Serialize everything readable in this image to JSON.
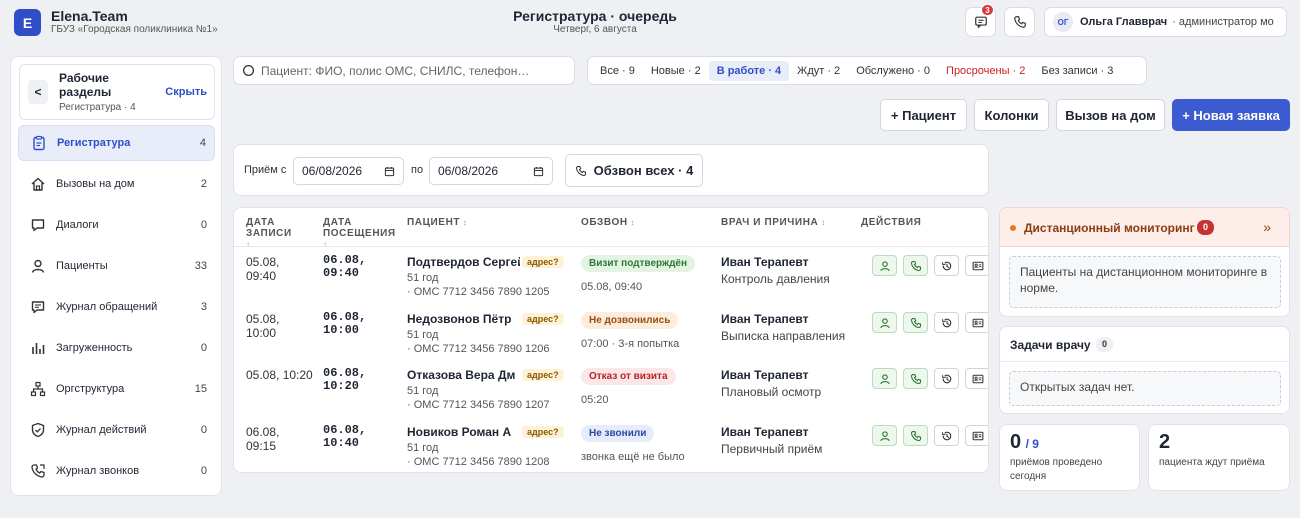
{
  "header": {
    "logo_letter": "E",
    "brand": "Elena.Team",
    "org": "ГБУЗ «Городская поликлиника №1»",
    "title": "Регистратура · очередь",
    "subtitle": "Четверг, 6 августа",
    "messages_badge": "3",
    "user_initials": "ОГ",
    "user_name": "Ольга Главврач",
    "user_role": "· администратор мо"
  },
  "sidebar": {
    "back_label": "<",
    "title": "Рабочие разделы",
    "subtitle": "Регистратура · 4",
    "hide_label": "Скрыть",
    "items": [
      {
        "label": "Регистратура",
        "count": "4",
        "icon": "clipboard-icon"
      },
      {
        "label": "Вызовы на дом",
        "count": "2",
        "icon": "home-icon"
      },
      {
        "label": "Диалоги",
        "count": "0",
        "icon": "chat-icon"
      },
      {
        "label": "Пациенты",
        "count": "33",
        "icon": "user-icon"
      },
      {
        "label": "Журнал обращений",
        "count": "3",
        "icon": "message-icon"
      },
      {
        "label": "Загруженность",
        "count": "0",
        "icon": "bar-chart-icon"
      },
      {
        "label": "Оргструктура",
        "count": "15",
        "icon": "org-tree-icon"
      },
      {
        "label": "Журнал действий",
        "count": "0",
        "icon": "shield-icon"
      },
      {
        "label": "Журнал звонков",
        "count": "0",
        "icon": "phone-icon"
      }
    ]
  },
  "search": {
    "placeholder": "Пациент: ФИО, полис ОМС, СНИЛС, телефон…"
  },
  "filters": [
    {
      "label": "Все · 9",
      "state": "normal"
    },
    {
      "label": "Новые · 2",
      "state": "normal"
    },
    {
      "label": "В работе · 4",
      "state": "active"
    },
    {
      "label": "Ждут · 2",
      "state": "normal"
    },
    {
      "label": "Обслужено · 0",
      "state": "normal"
    },
    {
      "label": "Просрочены · 2",
      "state": "red"
    },
    {
      "label": "Без записи · 3",
      "state": "normal"
    }
  ],
  "actions": {
    "patient": "+ Пациент",
    "columns": "Колонки",
    "home_call": "Вызов на дом",
    "new_request": "+ Новая заявка"
  },
  "date_filter": {
    "from_label": "Приём с",
    "from_value": "06/08/2026",
    "to_label": "по",
    "to_value": "06/08/2026",
    "call_all": "Обзвон всех · 4"
  },
  "table": {
    "columns": [
      "ДАТА ЗАПИСИ",
      "ДАТА ПОСЕЩЕНИЯ",
      "ПАЦИЕНТ",
      "ОБЗВОН",
      "ВРАЧ И ПРИЧИНА",
      "ДЕЙСТВИЯ"
    ],
    "rows": [
      {
        "rec_date": "05.08,",
        "rec_time": "09:40",
        "visit_date": "06.08,",
        "visit_time": "09:40",
        "patient": "Подтвердов Сергей",
        "addr": "адрес?",
        "age": "51 год",
        "oms": "· ОМС 7712 3456 7890 1205",
        "status": "Визит подтверждён",
        "status_kind": "green",
        "status_note": "05.08, 09:40",
        "doctor": "Иван Терапевт",
        "reason": "Контроль давления"
      },
      {
        "rec_date": "05.08,",
        "rec_time": "10:00",
        "visit_date": "06.08,",
        "visit_time": "10:00",
        "patient": "Недозвонов Пётр",
        "addr": "адрес?",
        "age": "51 год",
        "oms": "· ОМС 7712 3456 7890 1206",
        "status": "Не дозвонились",
        "status_kind": "orange",
        "status_note": "07:00 · 3-я попытка",
        "doctor": "Иван Терапевт",
        "reason": "Выписка направления"
      },
      {
        "rec_date": "05.08, 10:20",
        "rec_time": "",
        "visit_date": "06.08,",
        "visit_time": "10:20",
        "patient": "Отказова Вера Дм",
        "addr": "адрес?",
        "age": "51 год",
        "oms": "· ОМС 7712 3456 7890 1207",
        "status": "Отказ от визита",
        "status_kind": "red",
        "status_note": "05:20",
        "doctor": "Иван Терапевт",
        "reason": "Плановый осмотр"
      },
      {
        "rec_date": "06.08,",
        "rec_time": "09:15",
        "visit_date": "06.08,",
        "visit_time": "10:40",
        "patient": "Новиков Роман А",
        "addr": "адрес?",
        "age": "51 год",
        "oms": "· ОМС 7712 3456 7890 1208",
        "status": "Не звонили",
        "status_kind": "blue",
        "status_note": "звонка ещё не было",
        "doctor": "Иван Терапевт",
        "reason": "Первичный приём"
      }
    ]
  },
  "monitoring": {
    "title": "Дистанционный мониторинг",
    "count": "0",
    "expand": "»",
    "message": "Пациенты на дистанционном мониторинге в норме."
  },
  "tasks": {
    "title": "Задачи врачу",
    "count": "0",
    "message": "Открытых задач нет."
  },
  "stats": {
    "done_value": "0",
    "done_total": "/ 9",
    "done_label": "приёмов проведено сегодня",
    "waiting_value": "2",
    "waiting_label": "пациента ждут приёма"
  }
}
